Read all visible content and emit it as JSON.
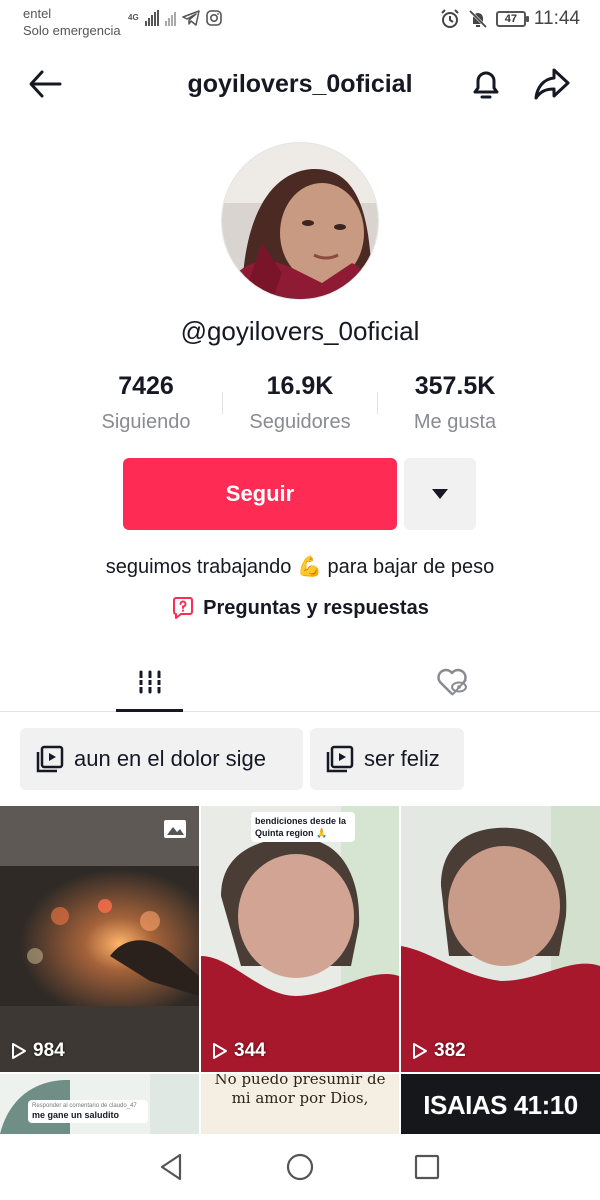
{
  "status_bar": {
    "carrier": "entel",
    "carrier_status": "Solo emergencia",
    "network": "4G",
    "battery": "47",
    "time": "11:44"
  },
  "header": {
    "title": "goyilovers_0oficial",
    "icons": [
      "back-arrow-icon",
      "bell-icon",
      "share-icon"
    ]
  },
  "profile": {
    "handle": "@goyilovers_0oficial",
    "stats": [
      {
        "value": "7426",
        "label": "Siguiendo"
      },
      {
        "value": "16.9K",
        "label": "Seguidores"
      },
      {
        "value": "357.5K",
        "label": "Me gusta"
      }
    ],
    "follow_label": "Seguir",
    "bio_part1": "seguimos trabajando",
    "bio_emoji": "💪",
    "bio_part2": "para bajar de peso",
    "qa_label": "Preguntas y respuestas"
  },
  "tabs": [
    "videos-grid",
    "liked-hidden"
  ],
  "playlists": [
    {
      "label": "aun en el dolor sige"
    },
    {
      "label": "ser feliz"
    }
  ],
  "videos": [
    {
      "views": "984",
      "caption": ""
    },
    {
      "views": "344",
      "caption": "bendiciones desde la Quinta region 🙏"
    },
    {
      "views": "382",
      "caption": ""
    },
    {
      "views": "",
      "caption": "me gane un saludito",
      "reply": "Responder al comentario de claudo_47"
    },
    {
      "views": "",
      "caption": "No puedo presumir de mi amor por Dios,"
    },
    {
      "views": "",
      "caption": "ISAIAS 41:10"
    }
  ],
  "colors": {
    "accent": "#fe2c55",
    "text": "#161823",
    "muted": "#8a8b91",
    "surface": "#f1f1f2"
  }
}
